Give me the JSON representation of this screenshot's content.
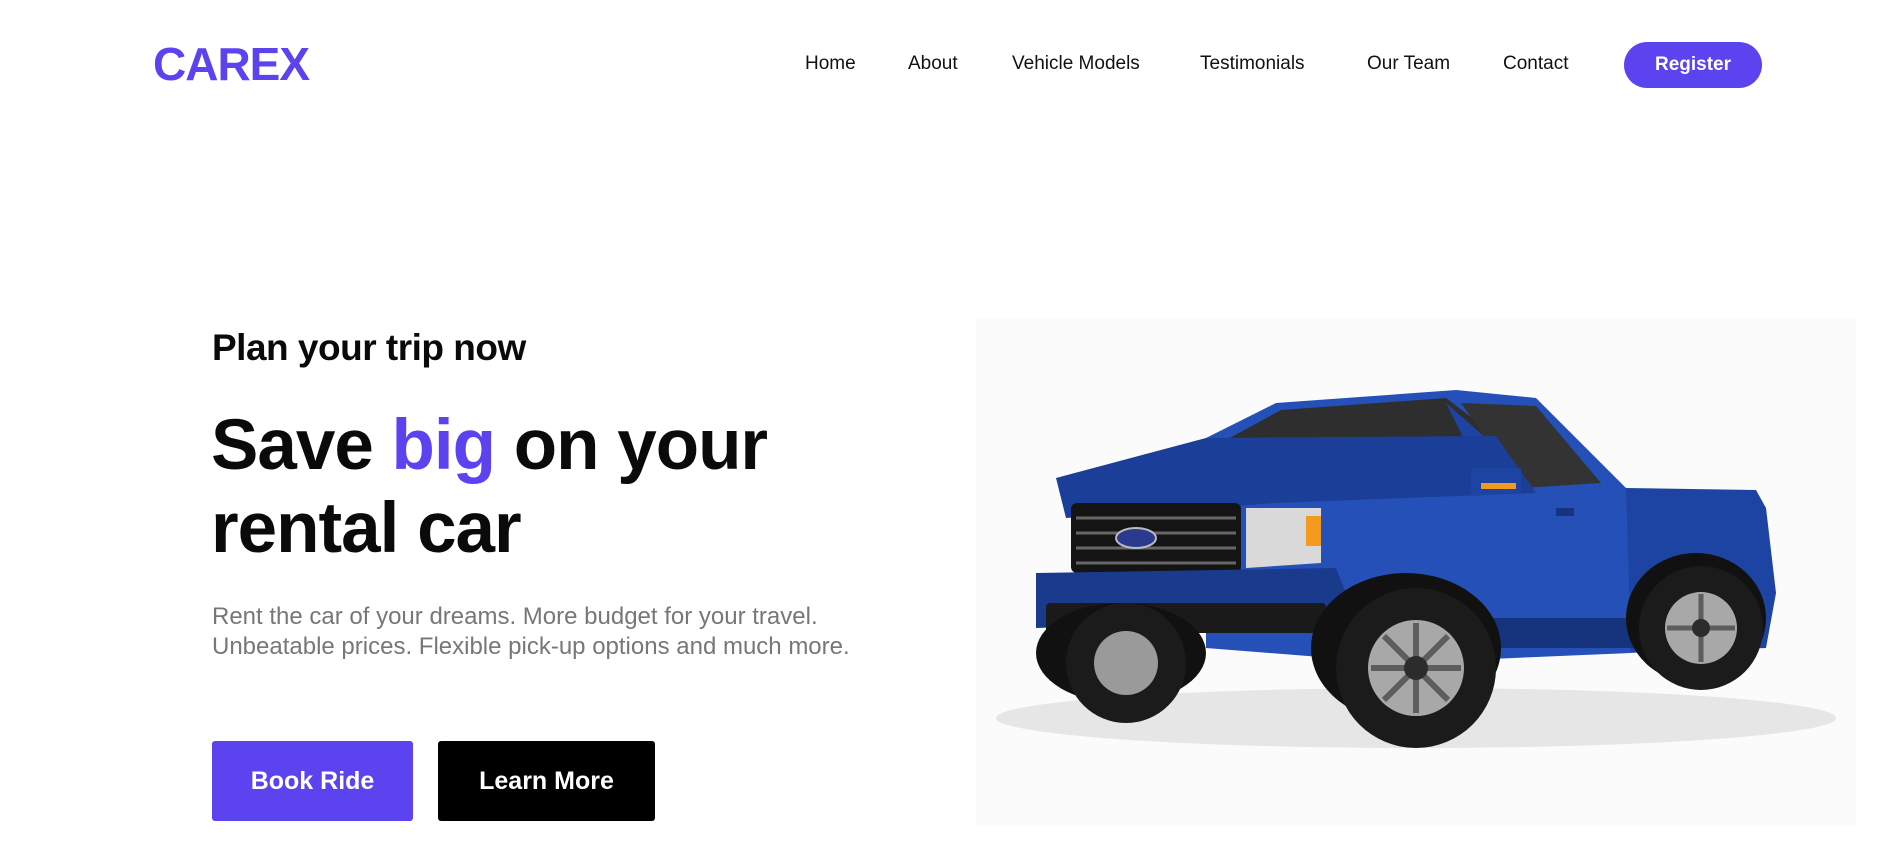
{
  "brand": {
    "logo_text": "CAREX",
    "accent_color": "#5b43f0"
  },
  "nav": {
    "links": [
      "Home",
      "About",
      "Vehicle Models",
      "Testimonials",
      "Our Team",
      "Contact"
    ],
    "register_label": "Register"
  },
  "hero": {
    "subtitle": "Plan your trip now",
    "headline_part1": "Save ",
    "headline_accent": "big",
    "headline_part2": " on your rental car",
    "description_line1": "Rent the car of your dreams. More budget for your travel.",
    "description_line2": "Unbeatable prices. Flexible pick-up options and much more.",
    "book_label": "Book Ride",
    "learn_label": "Learn More",
    "image_icon": "blue-pickup-truck-image",
    "truck_color": "#1f47a8"
  }
}
